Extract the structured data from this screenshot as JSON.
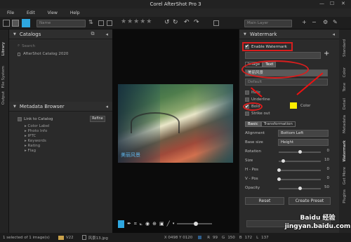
{
  "app": {
    "title": "Corel AfterShot Pro 3"
  },
  "menu": [
    "File",
    "Edit",
    "View",
    "Help"
  ],
  "toolbar": {
    "name_select": "Name",
    "main_layer": "Main Layer"
  },
  "left_tabs": [
    "Library",
    "File System",
    "Output"
  ],
  "catalogs": {
    "title": "Catalogs",
    "search_placeholder": "Search",
    "item": "AfterShot Catalog 2020"
  },
  "metadata": {
    "title": "Metadata Browser",
    "link_label": "Link to Catalog",
    "refine": "Refine",
    "items": [
      "Color Label",
      "Photo Info",
      "IPTC",
      "Keywords",
      "Rating",
      "Flag"
    ]
  },
  "viewer": {
    "overlay_text": "美丽风景"
  },
  "watermark": {
    "title": "Watermark",
    "enable_label": "Enable Watermark",
    "tabs": [
      "Image",
      "Text"
    ],
    "text_value": "美丽风景",
    "font_select": "Default",
    "italic": "Italic",
    "underline": "Underline",
    "bold": "Bold",
    "strikeout": "Strike out",
    "color_label": "Color",
    "color_swatch": "#ffee00",
    "sub_tabs": [
      "Basic",
      "Transformation"
    ],
    "alignment_label": "Alignment",
    "alignment_value": "Bottom Left",
    "basesize_label": "Base size",
    "basesize_value": "Height",
    "rotation_label": "Rotation",
    "rotation_value": "0",
    "size_label": "Size",
    "size_value": "10",
    "hpos_label": "H - Pos",
    "hpos_value": "0",
    "vpos_label": "V - Pos",
    "vpos_value": "0",
    "opacity_label": "Opacity",
    "opacity_value": "50",
    "reset": "Reset",
    "create_preset": "Create Preset"
  },
  "right_tabs": [
    "Standard",
    "Color",
    "Tone",
    "Detail",
    "Metadata",
    "Watermark",
    "Get More",
    "Plugins"
  ],
  "status": {
    "selected": "1 selected of 1 image(s)",
    "folder": "V22",
    "file": "风景13.jpg",
    "coords": "X 0498 Y 0120",
    "r": "R",
    "r_val": "99",
    "g": "G",
    "g_val": "150",
    "b": "B",
    "b_val": "172",
    "l": "L",
    "l_val": "137"
  },
  "watermark_site": "Baidu 经验\njingyan.baidu.com"
}
